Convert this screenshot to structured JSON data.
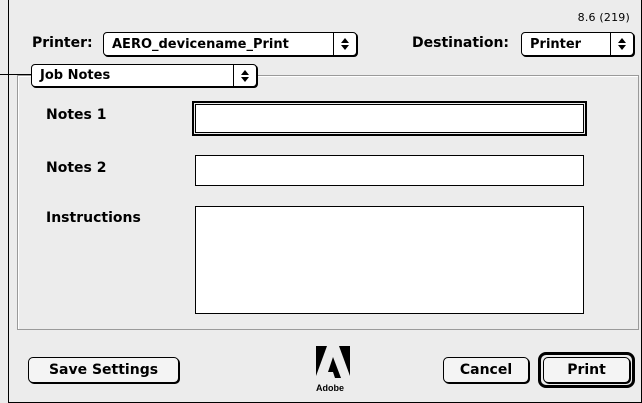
{
  "dialog": {
    "version": "8.6 (219)",
    "printer_label": "Printer:",
    "printer_value": "AERO_devicename_Print",
    "destination_label": "Destination:",
    "destination_value": "Printer",
    "panel_value": "Job Notes",
    "popup_arrows_glyph": "⬍"
  },
  "fields": {
    "notes1_label": "Notes 1",
    "notes1_value": "",
    "notes2_label": "Notes 2",
    "notes2_value": "",
    "instructions_label": "Instructions",
    "instructions_value": ""
  },
  "buttons": {
    "save_settings": "Save Settings",
    "cancel": "Cancel",
    "print": "Print"
  },
  "logo": {
    "name": "adobe-logo",
    "registered": "®",
    "text": "Adobe"
  }
}
